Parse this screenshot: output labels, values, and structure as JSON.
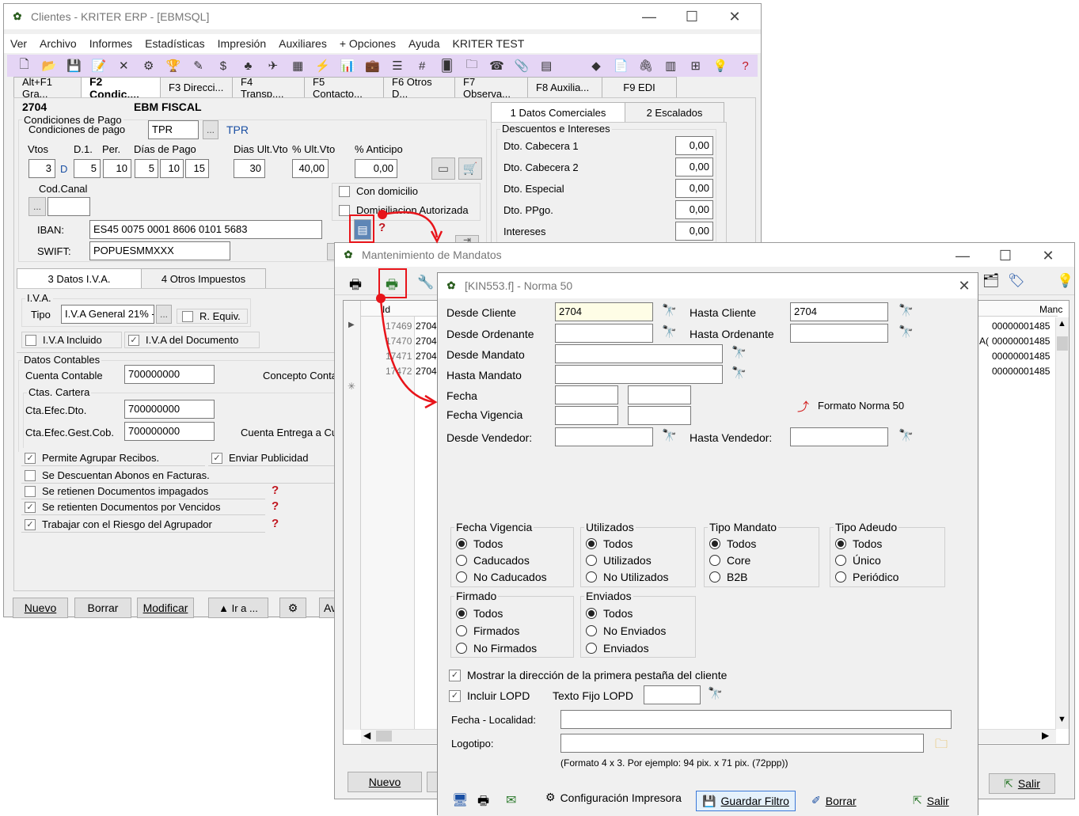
{
  "main": {
    "title": "Clientes - KRITER ERP - [EBMSQL]",
    "menu": [
      "Ver",
      "Archivo",
      "Informes",
      "Estadísticas",
      "Impresión",
      "Auxiliares",
      "+ Opciones",
      "Ayuda",
      "KRITER TEST"
    ],
    "tabs": [
      "Alt+F1 Gra...",
      "F2 Condic....",
      "F3 Direcci...",
      "F4 Transp....",
      "F5 Contacto...",
      "F6 Otros D...",
      "F7 Observa...",
      "F8 Auxilia...",
      "F9 EDI"
    ],
    "client_code": "2704",
    "client_name": "EBM FISCAL",
    "cond_pago": {
      "group_label": "Condiciones de Pago",
      "label": "Condiciones de pago",
      "value": "TPR",
      "desc": "TPR"
    },
    "headers": {
      "vtos": "Vtos",
      "d1": "D.1.",
      "per": "Per.",
      "dias_pago": "Días de Pago",
      "dias_ult": "Dias Ult.Vto",
      "pct_ult": "% Ult.Vto",
      "pct_anticipo": "% Anticipo"
    },
    "values": {
      "vtos": "3",
      "d": "D",
      "d1": "5",
      "per": "10",
      "dia1": "5",
      "dia2": "10",
      "dia3": "15",
      "dias_ult": "30",
      "pct_ult": "40,00",
      "anticipo": "0,00"
    },
    "cod_canal": "Cod.Canal",
    "con_domicilio": "Con domicilio",
    "domiciliacion": "Domiciliacion Autorizada",
    "iban_label": "IBAN:",
    "iban": "ES45 0075 0001 8606 0101 5683",
    "swift_label": "SWIFT:",
    "swift": "POPUESMMXXX",
    "right_tabs": [
      "1 Datos Comerciales",
      "2 Escalados"
    ],
    "descuentos_label": "Descuentos e Intereses",
    "descuentos": [
      {
        "label": "Dto. Cabecera 1",
        "value": "0,00"
      },
      {
        "label": "Dto. Cabecera 2",
        "value": "0,00"
      },
      {
        "label": "Dto. Especial",
        "value": "0,00"
      },
      {
        "label": "Dto. PPgo.",
        "value": "0,00"
      },
      {
        "label": "Intereses",
        "value": "0,00"
      }
    ],
    "lower_tabs": [
      "3 Datos I.V.A.",
      "4 Otros Impuestos"
    ],
    "iva_group": "I.V.A.",
    "tipo_label": "Tipo",
    "tipo_value": "I.V.A General 21% -",
    "r_equiv": "R. Equiv.",
    "iva_incluido": "I.V.A Incluido",
    "iva_documento": "I.V.A del Documento",
    "datos_contables": "Datos Contables",
    "cuenta_contable_label": "Cuenta Contable",
    "cuenta_contable": "700000000",
    "concepto_conta": "Concepto Conta",
    "ctas_cartera": "Ctas. Cartera",
    "cta_efec_dto_label": "Cta.Efec.Dto.",
    "cta_efec_dto": "700000000",
    "cta_efec_gest_label": "Cta.Efec.Gest.Cob.",
    "cta_efec_gest": "700000000",
    "cuenta_entrega": "Cuenta Entrega a Cu",
    "checks": [
      {
        "label": "Permite Agrupar Recibos.",
        "checked": "✓"
      },
      {
        "label": "Enviar Publicidad",
        "checked": "✓"
      },
      {
        "label": "Se Descuentan Abonos en Facturas.",
        "checked": ""
      },
      {
        "label": "Se retienen Documentos impagados",
        "checked": ""
      },
      {
        "label": "Se retienten Documentos por Vencidos",
        "checked": "✓"
      },
      {
        "label": "Trabajar con el Riesgo del Agrupador",
        "checked": "✓"
      }
    ],
    "bottom_buttons": [
      "Nuevo",
      "Borrar",
      "Modificar",
      "▲ Ir a ...",
      "Av"
    ]
  },
  "mandatos": {
    "title": "Mantenimiento de Mandatos",
    "grid_header": [
      "Id",
      "Manc"
    ],
    "rows": [
      {
        "id": "17469",
        "cliente": "2704",
        "mandato": "00000001485"
      },
      {
        "id": "17470",
        "cliente": "2704",
        "mandato": "00000001485"
      },
      {
        "id": "17471",
        "cliente": "2704",
        "mandato": "00000001485"
      },
      {
        "id": "17472",
        "cliente": "2704",
        "mandato": "00000001485"
      }
    ],
    "row2_prefix": "A(",
    "nuevo": "Nuevo",
    "salir": "Salir"
  },
  "report": {
    "title": "[KIN553.f] - Norma 50",
    "desde_cliente_label": "Desde Cliente",
    "desde_cliente": "2704",
    "hasta_cliente_label": "Hasta Cliente",
    "hasta_cliente": "2704",
    "desde_ordenante": "Desde Ordenante",
    "hasta_ordenante": "Hasta Ordenante",
    "desde_mandato": "Desde Mandato",
    "hasta_mandato": "Hasta Mandato",
    "fecha": "Fecha",
    "fecha_vigencia": "Fecha Vigencia",
    "formato": "Formato Norma 50",
    "desde_vendedor": "Desde Vendedor:",
    "hasta_vendedor": "Hasta Vendedor:",
    "groups": [
      {
        "title": "Fecha Vigencia",
        "options": [
          "Todos",
          "Caducados",
          "No Caducados"
        ],
        "selected": 0
      },
      {
        "title": "Utilizados",
        "options": [
          "Todos",
          "Utilizados",
          "No Utilizados"
        ],
        "selected": 0
      },
      {
        "title": "Tipo Mandato",
        "options": [
          "Todos",
          "Core",
          "B2B"
        ],
        "selected": 0
      },
      {
        "title": "Tipo Adeudo",
        "options": [
          "Todos",
          "Único",
          "Periódico"
        ],
        "selected": 0
      },
      {
        "title": "Firmado",
        "options": [
          "Todos",
          "Firmados",
          "No Firmados"
        ],
        "selected": 0
      },
      {
        "title": "Enviados",
        "options": [
          "Todos",
          "No Enviados",
          "Enviados"
        ],
        "selected": 0
      }
    ],
    "mostrar_direccion": "Mostrar la dirección de la primera pestaña del cliente",
    "incluir_lopd": "Incluir LOPD",
    "texto_fijo_lopd": "Texto Fijo LOPD",
    "fecha_localidad": "Fecha - Localidad:",
    "logotipo": "Logotipo:",
    "logo_hint": "(Formato 4 x 3. Por ejemplo: 94 pix. x 71 pix. (72ppp))",
    "config_impresora": "Configuración Impresora",
    "guardar_filtro": "Guardar Filtro",
    "borrar": "Borrar",
    "salir": "Salir"
  },
  "colors": {
    "accent_red": "#e8141a",
    "toolbar_bg": "#e5d5f5",
    "link_blue": "#1a4fa3"
  }
}
